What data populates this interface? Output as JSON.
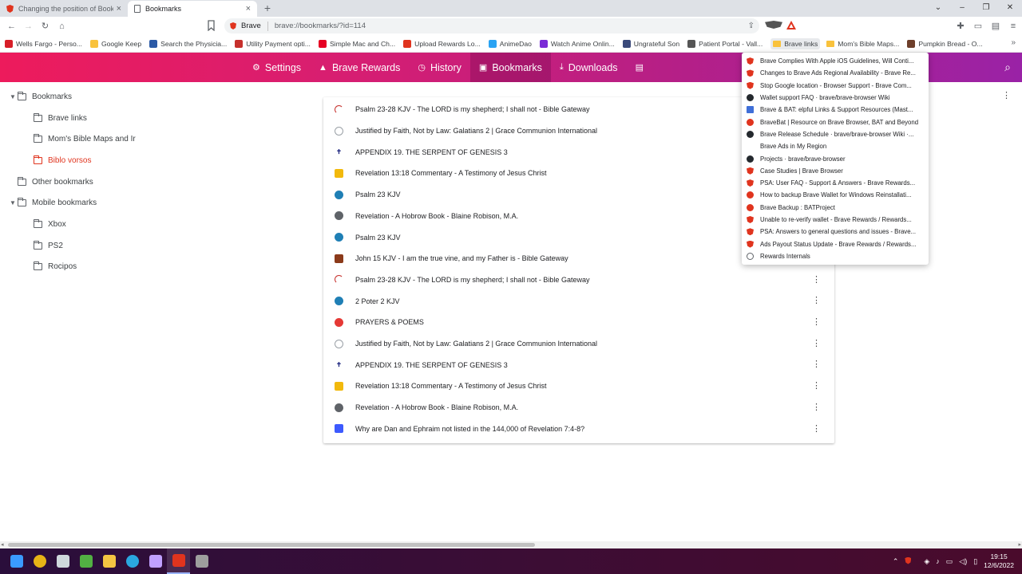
{
  "tabs": [
    {
      "title": "Changing the position of Bookmarks",
      "active": false
    },
    {
      "title": "Bookmarks",
      "active": true
    }
  ],
  "new_tab": "+",
  "window_controls": {
    "minimize": "–",
    "restore": "❐",
    "close": "✕",
    "collapse": "⌄"
  },
  "toolbar": {
    "back": "←",
    "forward": "→",
    "reload": "↻",
    "home": "⌂",
    "site_label": "Brave",
    "url": "brave://bookmarks/?id=114",
    "share": "⇪"
  },
  "bookmarks_bar": [
    {
      "label": "Wells Fargo - Perso...",
      "icon": "wells-fargo-icon",
      "color": "#d71e28"
    },
    {
      "label": "Google Keep",
      "icon": "keep-icon",
      "color": "#f9c23c"
    },
    {
      "label": "Search the Physicia...",
      "icon": "cms-icon",
      "color": "#2b5aa6"
    },
    {
      "label": "Utility Payment opti...",
      "icon": "utility-icon",
      "color": "#c6302c"
    },
    {
      "label": "Simple Mac and Ch...",
      "icon": "pinterest-icon",
      "color": "#e60023"
    },
    {
      "label": "Upload Rewards Lo...",
      "icon": "brave-icon",
      "color": "#e0341e"
    },
    {
      "label": "AnimeDao",
      "icon": "animedao-icon",
      "color": "#2aa3f3"
    },
    {
      "label": "Watch Anime Onlin...",
      "icon": "play-icon",
      "color": "#7a2bd6"
    },
    {
      "label": "Ungrateful Son",
      "icon": "ungrateful-icon",
      "color": "#3a4a7a"
    },
    {
      "label": "Patient Portal - Vall...",
      "icon": "portal-icon",
      "color": "#555555"
    },
    {
      "label": "Brave links",
      "icon": "folder-icon",
      "color": "#f9c23c",
      "active": true
    },
    {
      "label": "Mom's Bible Maps...",
      "icon": "folder-icon",
      "color": "#f9c23c"
    },
    {
      "label": "Pumpkin Bread - O...",
      "icon": "pumpkin-icon",
      "color": "#6d3e2a"
    }
  ],
  "header_nav": [
    {
      "label": "Settings",
      "icon": "gear-icon",
      "glyph": "⚙"
    },
    {
      "label": "Brave Rewards",
      "icon": "rewards-icon",
      "glyph": "▲"
    },
    {
      "label": "History",
      "icon": "history-icon",
      "glyph": "◷"
    },
    {
      "label": "Bookmarks",
      "icon": "bookmarks-icon",
      "glyph": "▣",
      "active": true
    },
    {
      "label": "Downloads",
      "icon": "download-icon",
      "glyph": "⤓"
    },
    {
      "label": "",
      "icon": "wallet-icon",
      "glyph": "▤"
    }
  ],
  "header_search": "⌕",
  "sidebar": [
    {
      "label": "Bookmarks",
      "level": 0,
      "expanded": true
    },
    {
      "label": "Brave links",
      "level": 1
    },
    {
      "label": "Mom's Bible Maps and Ir",
      "level": 1
    },
    {
      "label": "Biblo vorsos",
      "level": 1,
      "selected": true
    },
    {
      "label": "Other bookmarks",
      "level": 0
    },
    {
      "label": "Mobile bookmarks",
      "level": 0,
      "expanded": true
    },
    {
      "label": "Xbox",
      "level": 1
    },
    {
      "label": "PS2",
      "level": 1
    },
    {
      "label": "Rocipos",
      "level": 1
    }
  ],
  "bookmark_list": [
    {
      "title": "Psalm 23-28 KJV - The LORD is my shepherd; I shall not - Bible Gateway",
      "icon": "bible-gateway-icon",
      "color": "#c6302c"
    },
    {
      "title": "Justified by Faith, Not by Law: Galatians 2 | Grace Communion International",
      "icon": "globe-icon",
      "color": "#9aa0a6"
    },
    {
      "title": "APPENDIX 19. THE SERPENT OF GENESIS 3",
      "icon": "cross-icon",
      "color": "#1a237e"
    },
    {
      "title": "Revelation 13:18 Commentary - A Testimony of Jesus Christ",
      "icon": "testimony-icon",
      "color": "#f2b90c"
    },
    {
      "title": "Psalm 23 KJV",
      "icon": "kjv-icon",
      "color": "#1f7fb5"
    },
    {
      "title": "Revelation - A Hobrow Book - Blaine Robison, M.A.",
      "icon": "globe-dark-icon",
      "color": "#5f6368"
    },
    {
      "title": "Psalm 23 KJV",
      "icon": "kjv-icon",
      "color": "#1f7fb5"
    },
    {
      "title": "John 15 KJV - I am the true vine, and my Father is - Bible Gateway",
      "icon": "bible-icon",
      "color": "#8b3a1a"
    },
    {
      "title": "Psalm 23-28 KJV - The LORD is my shepherd; I shall not - Bible Gateway",
      "icon": "bible-gateway-icon",
      "color": "#c6302c"
    },
    {
      "title": "2 Poter 2 KJV",
      "icon": "kjv-icon",
      "color": "#1f7fb5"
    },
    {
      "title": "PRAYERS & POEMS",
      "icon": "prayers-icon",
      "color": "#e53935"
    },
    {
      "title": "Justified by Faith, Not by Law: Galatians 2 | Grace Communion International",
      "icon": "globe-icon",
      "color": "#9aa0a6"
    },
    {
      "title": "APPENDIX 19. THE SERPENT OF GENESIS 3",
      "icon": "cross-icon",
      "color": "#1a237e"
    },
    {
      "title": "Revelation 13:18 Commentary - A Testimony of Jesus Christ",
      "icon": "testimony-icon",
      "color": "#f2b90c"
    },
    {
      "title": "Revelation - A Hobrow Book - Blaine Robison, M.A.",
      "icon": "globe-dark-icon",
      "color": "#5f6368"
    },
    {
      "title": "Why are Dan and Ephraim not listed in the 144,000 of Revelation 7:4-8?",
      "icon": "article-icon",
      "color": "#3d5afe"
    }
  ],
  "dropdown": [
    {
      "label": "Brave Complies With Apple iOS Guidelines, Will Conti...",
      "icon": "shield"
    },
    {
      "label": "Changes to Brave Ads Regional Availability - Brave Re...",
      "icon": "shield"
    },
    {
      "label": "Stop Google location - Browser Support - Brave Com...",
      "icon": "shield"
    },
    {
      "label": "Wallet support FAQ · brave/brave-browser Wiki",
      "icon": "gh"
    },
    {
      "label": "Brave & BAT: elpful Links & Support Resources (Mast...",
      "icon": "blue"
    },
    {
      "label": "BraveBat | Resource on Brave Browser, BAT and Beyond",
      "icon": "rnd"
    },
    {
      "label": "Brave Release Schedule · brave/brave-browser Wiki ·...",
      "icon": "gh"
    },
    {
      "label": "Brave Ads in My Region",
      "icon": "blank"
    },
    {
      "label": "Projects · brave/brave-browser",
      "icon": "gh"
    },
    {
      "label": "Case Studies | Brave Browser",
      "icon": "shield"
    },
    {
      "label": "PSA: User FAQ - Support & Answers - Brave Rewards...",
      "icon": "shield"
    },
    {
      "label": "How to backup Brave Wallet for Windows Reinstallati...",
      "icon": "rnd"
    },
    {
      "label": "Brave Backup : BATProject",
      "icon": "rnd"
    },
    {
      "label": "Unable to re-verify wallet - Brave Rewards / Rewards...",
      "icon": "shield"
    },
    {
      "label": "PSA: Answers to general questions and issues - Brave...",
      "icon": "shield"
    },
    {
      "label": "Ads Payout Status Update - Brave Rewards / Rewards...",
      "icon": "shield"
    },
    {
      "label": "Rewards Internals",
      "icon": "globe"
    }
  ],
  "kebab": "⋮",
  "taskbar_apps": [
    {
      "name": "windows-start-icon",
      "color": "#3a9bff"
    },
    {
      "name": "chrome-icon",
      "color": "#e7b416"
    },
    {
      "name": "alien-icon",
      "color": "#cfd8dc"
    },
    {
      "name": "xbox-icon",
      "color": "#52b043"
    },
    {
      "name": "file-explorer-icon",
      "color": "#f4c542"
    },
    {
      "name": "edge-icon",
      "color": "#2aa7e0"
    },
    {
      "name": "brave-beta-icon",
      "color": "#c0a0ff"
    },
    {
      "name": "brave-icon",
      "color": "#e0341e",
      "active": true
    },
    {
      "name": "brave-nightly-icon",
      "color": "#9e9e9e"
    }
  ],
  "clock": {
    "time": "19:15",
    "date": "12/6/2022"
  },
  "tray": {
    "chevron": "⌃",
    "volume": "🔊"
  }
}
